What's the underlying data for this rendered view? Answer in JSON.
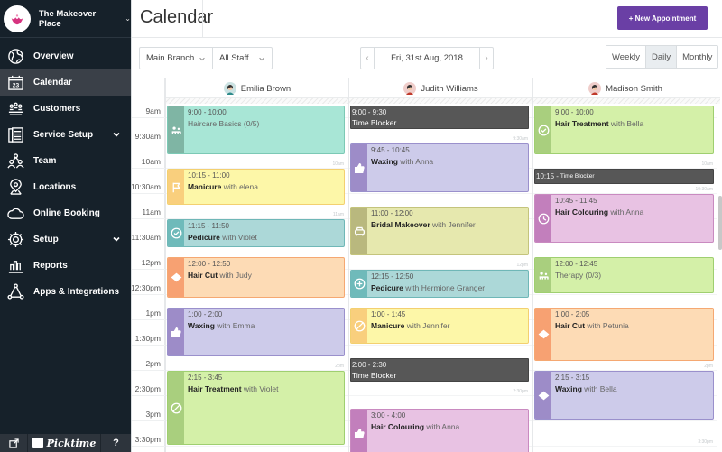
{
  "sidebar": {
    "brand": "The Makeover Place",
    "items": [
      {
        "label": "Overview",
        "icon": "globe-icon",
        "active": false,
        "expandable": false
      },
      {
        "label": "Calendar",
        "icon": "calendar-icon",
        "active": true,
        "expandable": false
      },
      {
        "label": "Customers",
        "icon": "customers-icon",
        "active": false,
        "expandable": false
      },
      {
        "label": "Service Setup",
        "icon": "services-icon",
        "active": false,
        "expandable": true
      },
      {
        "label": "Team",
        "icon": "team-icon",
        "active": false,
        "expandable": false
      },
      {
        "label": "Locations",
        "icon": "location-pin-icon",
        "active": false,
        "expandable": false
      },
      {
        "label": "Online Booking",
        "icon": "cloud-icon",
        "active": false,
        "expandable": false
      },
      {
        "label": "Setup",
        "icon": "gear-icon",
        "active": false,
        "expandable": true
      },
      {
        "label": "Reports",
        "icon": "bar-chart-icon",
        "active": false,
        "expandable": false
      },
      {
        "label": "Apps & Integrations",
        "icon": "integrations-icon",
        "active": false,
        "expandable": false
      }
    ],
    "footer": {
      "logo_text": "Picktime",
      "help": "?"
    }
  },
  "header": {
    "title": "Calendar",
    "new_appointment": "+ New Appointment"
  },
  "toolbar": {
    "branch": "Main Branch",
    "staff": "All Staff",
    "date": "Fri, 31st Aug, 2018",
    "prev": "‹",
    "next": "›",
    "views": [
      "Weekly",
      "Daily",
      "Monthly"
    ],
    "active_view": "Daily"
  },
  "calendar": {
    "time_labels": [
      "9am",
      "9:30am",
      "10am",
      "10:30am",
      "11am",
      "11:30am",
      "12pm",
      "12:30pm",
      "1pm",
      "1:30pm",
      "2pm",
      "2:30pm",
      "3pm",
      "3:30pm"
    ],
    "minor_labels": {
      "10am": "10am",
      "11am": "11am",
      "9:30am": "9:30am",
      "12pm": "12pm",
      "2:30pm": "2:30pm",
      "10:30am": "10:30am",
      "2pm": "2pm",
      "3:30pm": "3:30pm"
    },
    "staff": [
      {
        "name": "Emilia Brown",
        "avatar_color": "#2e8b8b",
        "minor": [
          "10am",
          "11am",
          "2pm"
        ],
        "events": [
          {
            "type": "appt",
            "start": 9.0,
            "end": 10.0,
            "time": "9:00 - 10:00",
            "service": "",
            "rest": "Haircare Basics (0/5)",
            "bg": "#a8e6d6",
            "border": "#7cc9b5",
            "strip": "#7fb5a4",
            "icon": "class-icon"
          },
          {
            "type": "appt",
            "start": 10.25,
            "end": 11.0,
            "time": "10:15 - 11:00",
            "service": "Manicure",
            "rest": " with elena",
            "bg": "#fdf7a8",
            "border": "#f3d070",
            "strip": "#f9cf7d",
            "icon": "flag-icon"
          },
          {
            "type": "appt",
            "start": 11.25,
            "end": 11.833,
            "time": "11:15 - 11:50",
            "service": "Pedicure",
            "rest": " with Violet",
            "bg": "#acd8d8",
            "border": "#6fb7b7",
            "strip": "#6fbaba",
            "icon": "check-circle-icon"
          },
          {
            "type": "appt",
            "start": 12.0,
            "end": 12.833,
            "time": "12:00 - 12:50",
            "service": "Hair Cut",
            "rest": " with Judy",
            "bg": "#fddbb5",
            "border": "#f5a872",
            "strip": "#f7a172",
            "icon": "ticket-icon"
          },
          {
            "type": "appt",
            "start": 13.0,
            "end": 14.0,
            "time": "1:00 - 2:00",
            "service": "Waxing",
            "rest": " with Emma",
            "bg": "#cdcbea",
            "border": "#9a90cc",
            "strip": "#9d8cc8",
            "icon": "thumbs-up-icon"
          },
          {
            "type": "appt",
            "start": 14.25,
            "end": 15.75,
            "time": "2:15 - 3:45",
            "service": "Hair Treatment",
            "rest": " with Violet",
            "bg": "#d4f0a8",
            "border": "#9fcf70",
            "strip": "#a9cf7e",
            "icon": "blocked-icon"
          }
        ]
      },
      {
        "name": "Judith Williams",
        "avatar_color": "#c0392b",
        "minor": [
          "9:30am",
          "12pm",
          "2:30pm"
        ],
        "events": [
          {
            "type": "blocker",
            "start": 9.0,
            "end": 9.5,
            "time": "9:00 - 9:30",
            "label": "Time Blocker"
          },
          {
            "type": "appt",
            "start": 9.75,
            "end": 10.75,
            "time": "9:45 - 10:45",
            "service": "Waxing",
            "rest": " with Anna",
            "bg": "#cdcbea",
            "border": "#9a90cc",
            "strip": "#9d8cc8",
            "icon": "thumbs-up-icon"
          },
          {
            "type": "appt",
            "start": 11.0,
            "end": 12.0,
            "time": "11:00 - 12:00",
            "service": "Bridal Makeover",
            "rest": " with Jennifer",
            "bg": "#e6e8ae",
            "border": "#c4c47c",
            "strip": "#b9b87e",
            "icon": "car-icon"
          },
          {
            "type": "appt",
            "start": 12.25,
            "end": 12.833,
            "time": "12:15 - 12:50",
            "service": "Pedicure",
            "rest": " with Hermione Granger",
            "bg": "#acd8d8",
            "border": "#6fb7b7",
            "strip": "#6fbaba",
            "icon": "plus-circle-icon"
          },
          {
            "type": "appt",
            "start": 13.0,
            "end": 13.75,
            "time": "1:00 - 1:45",
            "service": "Manicure",
            "rest": " with Jennifer",
            "bg": "#fdf7a8",
            "border": "#f3d070",
            "strip": "#f9cf7d",
            "icon": "blocked-icon"
          },
          {
            "type": "blocker",
            "start": 14.0,
            "end": 14.5,
            "time": "2:00 - 2:30",
            "label": "Time Blocker"
          },
          {
            "type": "appt",
            "start": 15.0,
            "end": 16.0,
            "time": "3:00 - 4:00",
            "service": "Hair Colouring",
            "rest": " with Anna",
            "bg": "#e8c2e3",
            "border": "#c98ac0",
            "strip": "#c27fbc",
            "icon": "thumbs-up-icon"
          }
        ]
      },
      {
        "name": "Madison Smith",
        "avatar_color": "#c0392b",
        "minor": [
          "10am",
          "10:30am",
          "2pm",
          "3:30pm"
        ],
        "events": [
          {
            "type": "appt",
            "start": 9.0,
            "end": 10.0,
            "time": "9:00 - 10:00",
            "service": "Hair Treatment",
            "rest": " with Bella",
            "bg": "#d4f0a8",
            "border": "#9fcf70",
            "strip": "#a9cf7e",
            "icon": "check-circle-icon"
          },
          {
            "type": "blocker-inline",
            "start": 10.25,
            "end": 10.583,
            "time": "10:15 -",
            "label": "Time Blocker"
          },
          {
            "type": "appt",
            "start": 10.75,
            "end": 11.75,
            "time": "10:45 - 11:45",
            "service": "Hair Colouring",
            "rest": " with Anna",
            "bg": "#e8c2e3",
            "border": "#c98ac0",
            "strip": "#c27fbc",
            "icon": "clock-icon"
          },
          {
            "type": "appt",
            "start": 12.0,
            "end": 12.75,
            "time": "12:00 - 12:45",
            "service": "",
            "rest": "Therapy (0/3)",
            "bg": "#d4f0a8",
            "border": "#9fcf70",
            "strip": "#a9cf7e",
            "icon": "class-icon"
          },
          {
            "type": "appt",
            "start": 13.0,
            "end": 14.083,
            "time": "1:00 - 2:05",
            "service": "Hair Cut",
            "rest": " with Petunia",
            "bg": "#fddbb5",
            "border": "#f5a872",
            "strip": "#f7a172",
            "icon": "ticket-icon"
          },
          {
            "type": "appt",
            "start": 14.25,
            "end": 15.25,
            "time": "2:15 - 3:15",
            "service": "Waxing",
            "rest": " with Bella",
            "bg": "#cdcbea",
            "border": "#9a90cc",
            "strip": "#9d8cc8",
            "icon": "ticket-icon"
          }
        ]
      }
    ]
  }
}
